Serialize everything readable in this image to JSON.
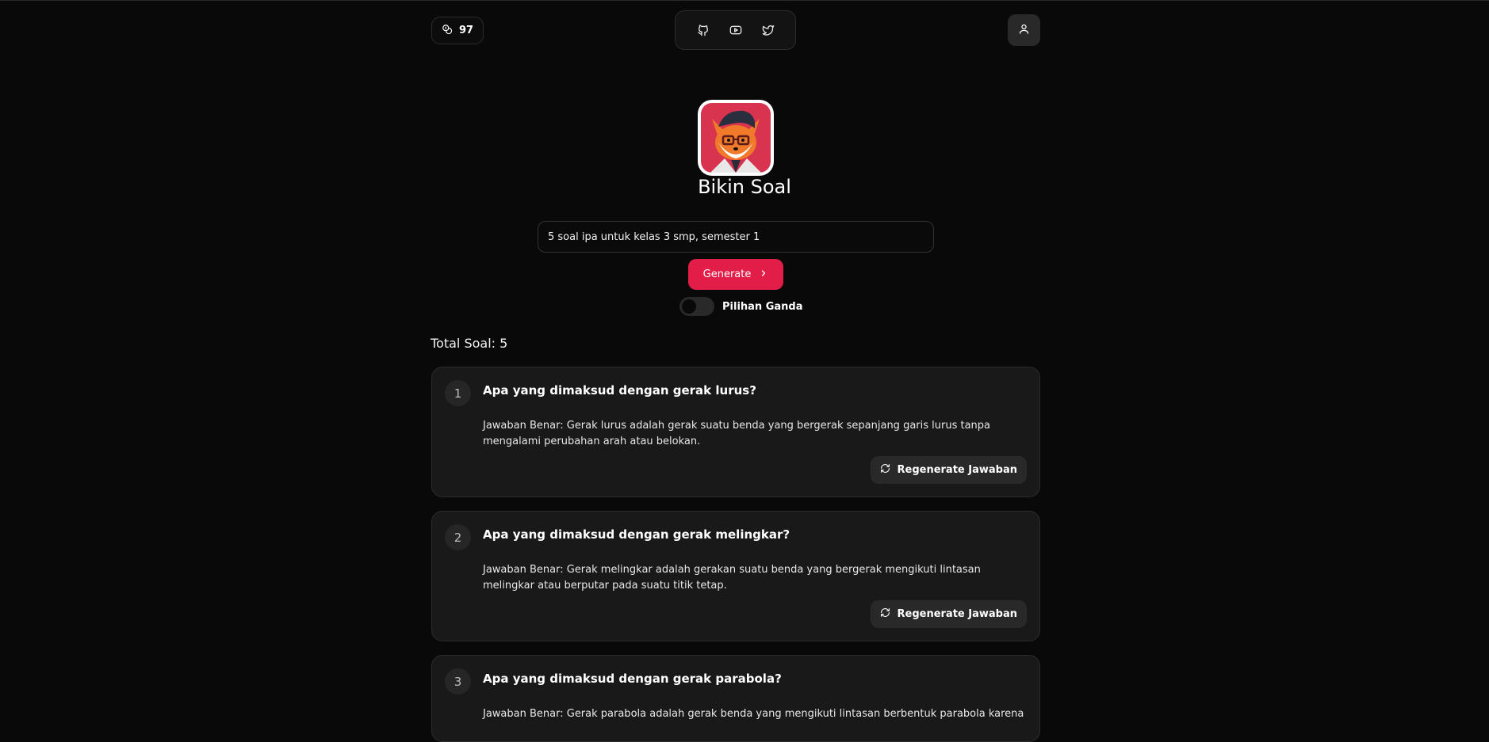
{
  "header": {
    "credits": "97",
    "social_icons": [
      "github-icon",
      "youtube-icon",
      "twitter-icon"
    ],
    "user_icon": "user-icon"
  },
  "app": {
    "title": "Bikin Soal",
    "prompt_value": "5 soal ipa untuk kelas 3 smp, semester 1",
    "generate_label": "Generate",
    "toggle_label": "Pilihan Ganda",
    "toggle_on": false
  },
  "results": {
    "total_label": "Total Soal: 5",
    "regen_label": "Regenerate Jawaban",
    "questions": [
      {
        "number": "1",
        "question": "Apa yang dimaksud dengan gerak lurus?",
        "answer": "Jawaban Benar: Gerak lurus adalah gerak suatu benda yang bergerak sepanjang garis lurus tanpa mengalami perubahan arah atau belokan."
      },
      {
        "number": "2",
        "question": "Apa yang dimaksud dengan gerak melingkar?",
        "answer": "Jawaban Benar: Gerak melingkar adalah gerakan suatu benda yang bergerak mengikuti lintasan melingkar atau berputar pada suatu titik tetap."
      },
      {
        "number": "3",
        "question": "Apa yang dimaksud dengan gerak parabola?",
        "answer": "Jawaban Benar: Gerak parabola adalah gerak benda yang mengikuti lintasan berbentuk parabola karena"
      }
    ]
  },
  "colors": {
    "background": "#0a0909",
    "card": "#1a1919",
    "accent": "#e11d48"
  }
}
